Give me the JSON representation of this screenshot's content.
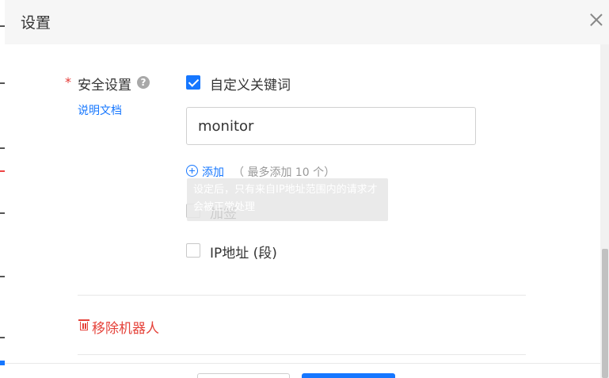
{
  "dialog": {
    "title": "设置"
  },
  "security": {
    "required_mark": "*",
    "label": "安全设置",
    "help_icon": "?",
    "doc_link": "说明文档",
    "custom_keyword": {
      "label": "自定义关键词",
      "checked": true,
      "value": "monitor",
      "add_label": "添加",
      "add_hint": "（ 最多添加 10 个）"
    },
    "tooltip": "设定后，只有来自IP地址范围内的请求才会被正常处理",
    "sign": {
      "label": "加签",
      "checked": false
    },
    "ip": {
      "label": "IP地址 (段)",
      "checked": false
    }
  },
  "remove_robot": {
    "label": "移除机器人"
  },
  "colors": {
    "accent": "#1677ff",
    "danger": "#e5433b",
    "required": "#e53935"
  }
}
